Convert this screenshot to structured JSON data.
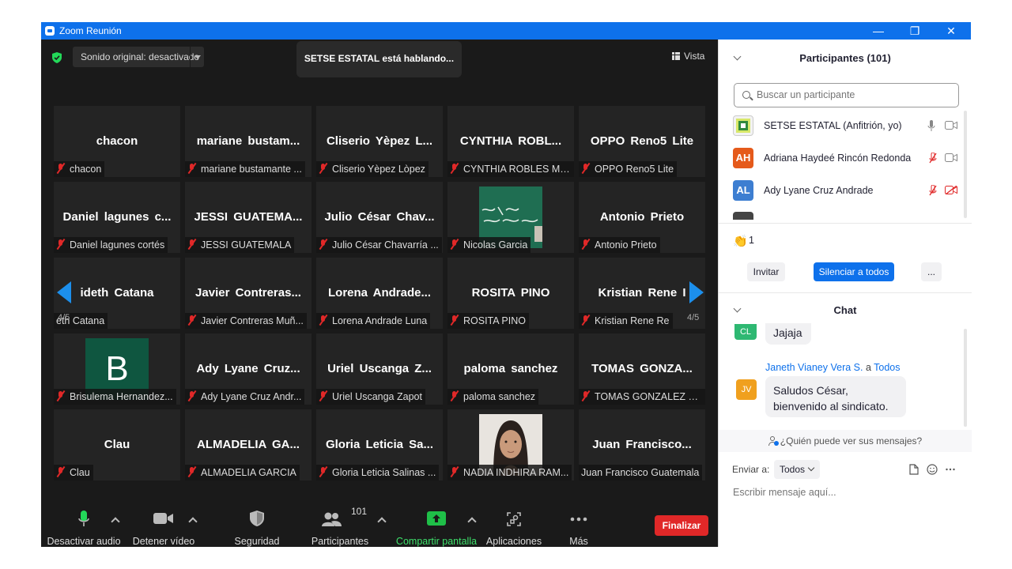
{
  "window": {
    "title": "Zoom Reunión",
    "minimize": "—",
    "restore": "❐",
    "close": "✕"
  },
  "top": {
    "sound_label": "Sonido original: desactivado",
    "speaker_banner": "SETSE ESTATAL está hablando...",
    "view_label": "Vista"
  },
  "pager": {
    "left": "4/5",
    "right": "4/5"
  },
  "tiles": [
    {
      "big": "chacon",
      "label": "chacon",
      "muted": true
    },
    {
      "big": "mariane bustam...",
      "label": "mariane bustamante ...",
      "muted": true
    },
    {
      "big": "Cliserio Yèpez L...",
      "label": "Cliserio Yèpez Lòpez",
      "muted": true
    },
    {
      "big": "CYNTHIA ROBL...",
      "label": "CYNTHIA ROBLES ME...",
      "muted": true
    },
    {
      "big": "OPPO Reno5 Lite",
      "label": "OPPO Reno5 Lite",
      "muted": true
    },
    {
      "big": "Daniel lagunes c...",
      "label": "Daniel lagunes cortés",
      "muted": true
    },
    {
      "big": "JESSI GUATEMA...",
      "label": "JESSI GUATEMALA",
      "muted": true
    },
    {
      "big": "Julio César Chav...",
      "label": "Julio César Chavarría ...",
      "muted": true
    },
    {
      "big": "",
      "label": "Nicolas Garcia",
      "muted": true,
      "photo": "chalkboard"
    },
    {
      "big": "Antonio Prieto",
      "label": "Antonio Prieto",
      "muted": true
    },
    {
      "big": "ideth Catana",
      "label": "eth Catana",
      "muted": false
    },
    {
      "big": "Javier Contreras...",
      "label": "Javier Contreras Muñ...",
      "muted": true
    },
    {
      "big": "Lorena Andrade...",
      "label": "Lorena Andrade Luna",
      "muted": true
    },
    {
      "big": "ROSITA PINO",
      "label": "ROSITA PINO",
      "muted": true
    },
    {
      "big": "Kristian Rene I",
      "label": "Kristian Rene Re",
      "muted": true
    },
    {
      "big": "",
      "label": "Brisulema Hernandez...",
      "muted": true,
      "photo": "letter",
      "letter": "B"
    },
    {
      "big": "Ady Lyane Cruz...",
      "label": "Ady Lyane Cruz Andr...",
      "muted": true
    },
    {
      "big": "Uriel Uscanga Z...",
      "label": "Uriel Uscanga Zapot",
      "muted": true
    },
    {
      "big": "paloma sanchez",
      "label": "paloma sanchez",
      "muted": true
    },
    {
      "big": "TOMAS GONZA...",
      "label": "TOMAS GONZALEZ H...",
      "muted": true
    },
    {
      "big": "Clau",
      "label": "Clau",
      "muted": true
    },
    {
      "big": "ALMADELIA GA...",
      "label": "ALMADELIA GARCIA",
      "muted": true
    },
    {
      "big": "Gloria Leticia Sa...",
      "label": "Gloria Leticia Salinas ...",
      "muted": true
    },
    {
      "big": "",
      "label": "NADIA INDHIRA RAM...",
      "muted": true,
      "photo": "face"
    },
    {
      "big": "Juan Francisco...",
      "label": "Juan Francisco Guatemala",
      "muted": false
    }
  ],
  "toolbar": {
    "audio": "Desactivar audio",
    "video": "Detener vídeo",
    "security": "Seguridad",
    "participants": "Participantes",
    "participants_count": "101",
    "share": "Compartir pantalla",
    "apps": "Aplicaciones",
    "more": "Más",
    "end": "Finalizar"
  },
  "participants_panel": {
    "title": "Participantes (101)",
    "search_placeholder": "Buscar un participante",
    "rows": [
      {
        "initials": "",
        "name": "SETSE ESTATAL (Anfitrión, yo)",
        "avatar_color": "#f3f3f3",
        "mic": "on",
        "cam": "off-plain"
      },
      {
        "initials": "AH",
        "name": "Adriana Haydeé Rincón Redonda",
        "avatar_color": "#e55a1b",
        "mic": "muted",
        "cam": "off-plain"
      },
      {
        "initials": "AL",
        "name": "Ady Lyane Cruz Andrade",
        "avatar_color": "#3d7ed1",
        "mic": "muted",
        "cam": "muted"
      }
    ],
    "raised_hands": "1",
    "invite": "Invitar",
    "mute_all": "Silenciar a todos",
    "more": "..."
  },
  "chat": {
    "title": "Chat",
    "msg1": {
      "initials": "CL",
      "avatar_color": "#2eb872",
      "text": "Jajaja"
    },
    "msg2": {
      "sender": "Janeth Vianey Vera S.",
      "connector": "a",
      "recipient": "Todos",
      "initials": "JV",
      "avatar_color": "#f0a01e",
      "line1": "Saludos César,",
      "line2": "bienvenido al sindicato."
    },
    "who_can_see": "¿Quién puede ver sus mensajes?",
    "send_to_label": "Enviar a:",
    "send_to_value": "Todos",
    "placeholder": "Escribir mensaje aquí..."
  },
  "colors": {
    "accent": "#0e71eb",
    "danger": "#e02828",
    "share": "#1fbf48"
  }
}
